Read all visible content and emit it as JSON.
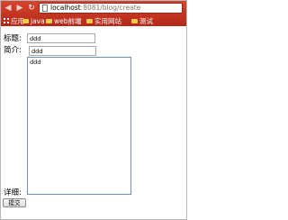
{
  "browser": {
    "url_host": "localhost",
    "url_rest": ":8081/blog/create",
    "bookmarks": [
      {
        "label": "应用",
        "icon": "apps-grid-icon"
      },
      {
        "label": "java",
        "icon": "folder-icon"
      },
      {
        "label": "web前端",
        "icon": "folder-icon"
      },
      {
        "label": "实用网站",
        "icon": "folder-icon"
      },
      {
        "label": "测试",
        "icon": "folder-icon"
      }
    ]
  },
  "form": {
    "title_label": "标题:",
    "title_value": "ddd",
    "summary_label": "简介:",
    "summary_value": "ddd",
    "detail_label": "详细:",
    "detail_value": "ddd",
    "submit_label": "提交"
  },
  "colors": {
    "chrome": "#c9351f",
    "folder": "#f2c94c",
    "textarea_border": "#6f8fb0"
  }
}
